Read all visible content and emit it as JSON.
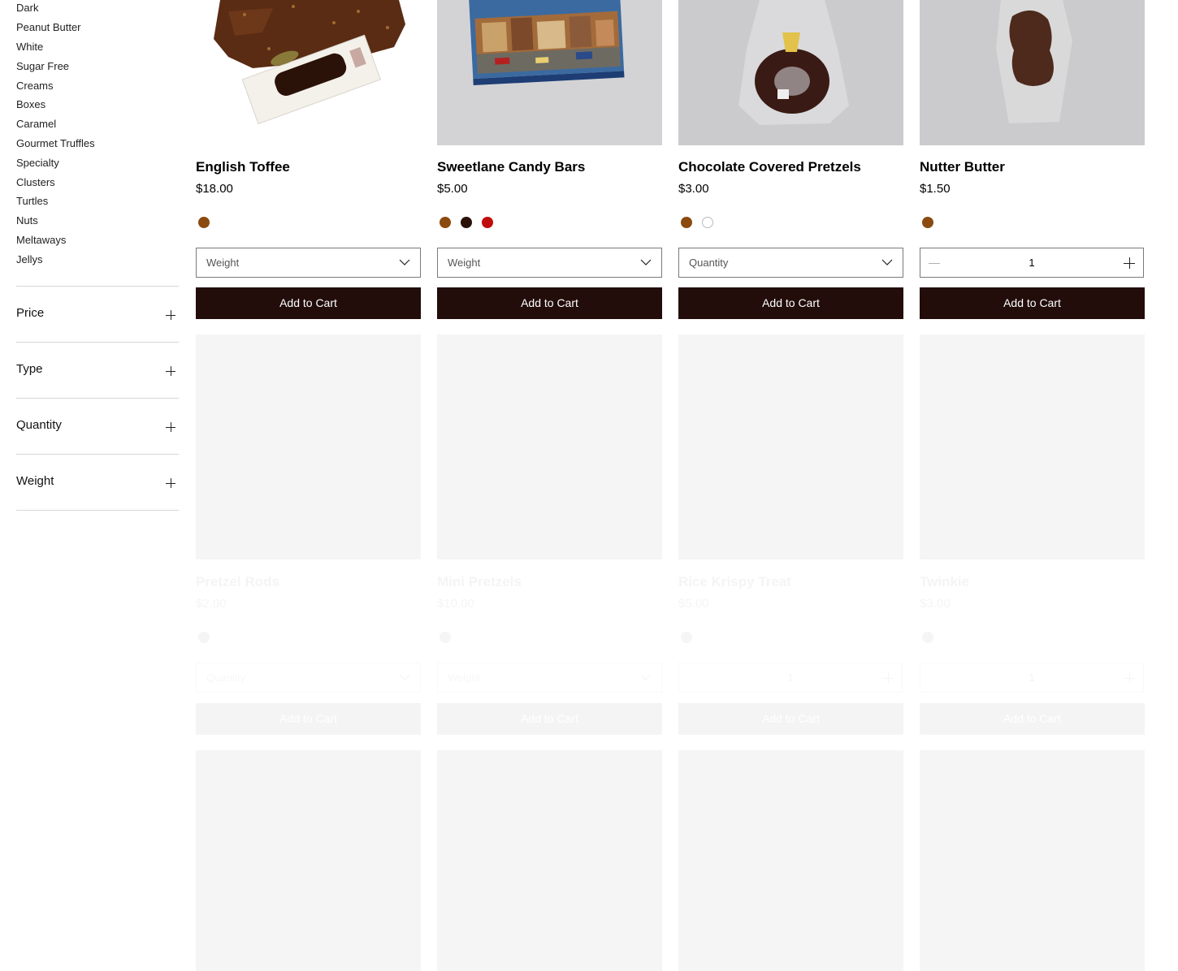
{
  "sidebar": {
    "categories": [
      "Dark",
      "Peanut Butter",
      "White",
      "Sugar Free",
      "Creams",
      "Boxes",
      "Caramel",
      "Gourmet Truffles",
      "Specialty",
      "Clusters",
      "Turtles",
      "Nuts",
      "Meltaways",
      "Jellys"
    ],
    "filters": [
      "Price",
      "Type",
      "Quantity",
      "Weight"
    ]
  },
  "products": [
    {
      "name": "English Toffee",
      "price": "$18.00",
      "swatches": [
        "#8a4a10"
      ],
      "option": "Weight",
      "button": "Add to Cart"
    },
    {
      "name": "Sweetlane Candy Bars",
      "price": "$5.00",
      "swatches": [
        "#8a4a10",
        "#2a1208",
        "#c00d0d"
      ],
      "option": "Weight",
      "button": "Add to Cart"
    },
    {
      "name": "Chocolate Covered Pretzels",
      "price": "$3.00",
      "swatches": [
        "#8a4a10",
        "#ffffff"
      ],
      "option": "Quantity",
      "button": "Add to Cart"
    },
    {
      "name": "Nutter Butter",
      "price": "$1.50",
      "swatches": [
        "#8a4a10"
      ],
      "quantity": "1",
      "button": "Add to Cart"
    },
    {
      "name": "Pretzel Rods",
      "price": "$2.00",
      "swatches": [
        "#222222"
      ],
      "option": "Quantity",
      "button": "Add to Cart"
    },
    {
      "name": "Mini Pretzels",
      "price": "$10.00",
      "swatches": [
        "#222222"
      ],
      "option": "Weight",
      "button": "Add to Cart"
    },
    {
      "name": "Rice Krispy Treat",
      "price": "$5.00",
      "swatches": [
        "#222222"
      ],
      "quantity": "1",
      "button": "Add to Cart"
    },
    {
      "name": "Twinkie",
      "price": "$3.00",
      "swatches": [
        "#222222"
      ],
      "quantity": "1",
      "button": "Add to Cart"
    }
  ],
  "colors": {
    "button_bg": "#220d0b",
    "button_text": "#ffffff",
    "divider": "#d6d6d6"
  }
}
